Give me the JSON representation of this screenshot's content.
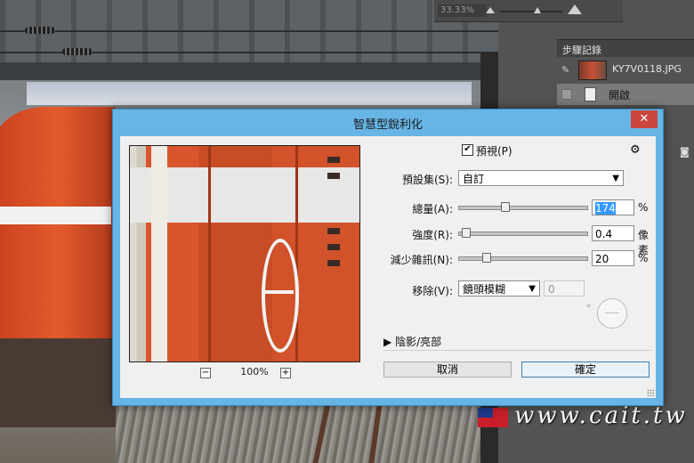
{
  "dialog": {
    "title": "智慧型銳利化",
    "close_label": "✕"
  },
  "preview": {
    "preview_checked": true,
    "preview_label": "預視(P)",
    "zoom_out": "−",
    "zoom_in": "+",
    "zoom_level": "100%"
  },
  "settings": {
    "preset_label": "預設集(S):",
    "preset_value": "自訂",
    "amount_label": "總量(A):",
    "amount_value": "174",
    "amount_unit": "%",
    "amount_level": 0.35,
    "radius_label": "強度(R):",
    "radius_value": "0.4",
    "radius_unit": "像素",
    "radius_level": 0.03,
    "noise_label": "減少雜訊(N):",
    "noise_value": "20",
    "noise_unit": "%",
    "noise_level": 0.2,
    "remove_label": "移除(V):",
    "remove_value": "鏡頭模糊",
    "angle_value": "0",
    "angle_unit": "°",
    "shadows_label": "陰影/亮部"
  },
  "buttons": {
    "cancel": "取消",
    "ok": "確定"
  },
  "photoshop": {
    "navigator_zoom": "33.33%",
    "history_title": "步驟記錄",
    "history_file": "KY7V0118.JPG",
    "history_open": "開啟"
  },
  "watermark": "www.cait.tw"
}
